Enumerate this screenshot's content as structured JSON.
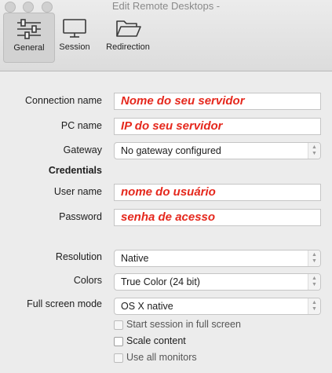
{
  "window": {
    "title": "Edit Remote Desktops -"
  },
  "toolbar": {
    "tabs": [
      {
        "label": "General",
        "icon": "sliders-icon",
        "active": true
      },
      {
        "label": "Session",
        "icon": "monitor-icon",
        "active": false
      },
      {
        "label": "Redirection",
        "icon": "folder-icon",
        "active": false
      }
    ]
  },
  "form": {
    "connection_name": {
      "label": "Connection name",
      "value": "Nome do seu servidor"
    },
    "pc_name": {
      "label": "PC name",
      "value": "IP do seu servidor"
    },
    "gateway": {
      "label": "Gateway",
      "value": "No gateway configured"
    },
    "credentials_heading": "Credentials",
    "user_name": {
      "label": "User name",
      "value": "nome do usuário"
    },
    "password": {
      "label": "Password",
      "value": "senha de acesso"
    },
    "resolution": {
      "label": "Resolution",
      "value": "Native"
    },
    "colors": {
      "label": "Colors",
      "value": "True Color (24 bit)"
    },
    "full_screen_mode": {
      "label": "Full screen mode",
      "value": "OS X native"
    },
    "checkboxes": [
      {
        "label": "Start session in full screen",
        "checked": false
      },
      {
        "label": "Scale content",
        "checked": false
      },
      {
        "label": "Use all monitors",
        "checked": false
      }
    ]
  },
  "colors": {
    "annotation_red": "#e5281d",
    "window_bg": "#ececec"
  }
}
